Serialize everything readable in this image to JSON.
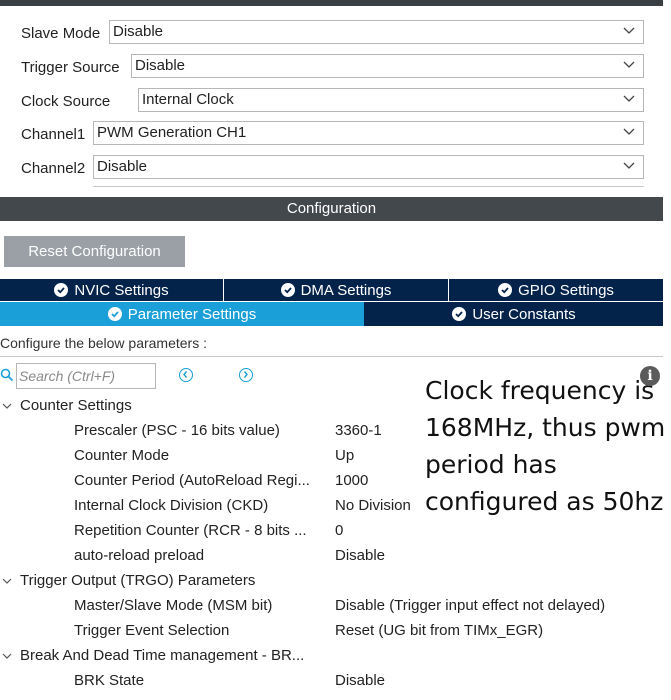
{
  "mode": {
    "slave_mode": {
      "label": "Slave Mode",
      "value": "Disable"
    },
    "trigger_source": {
      "label": "Trigger Source",
      "value": "Disable"
    },
    "clock_source": {
      "label": "Clock Source",
      "value": "Internal Clock"
    },
    "channel1": {
      "label": "Channel1",
      "value": "PWM Generation CH1"
    },
    "channel2": {
      "label": "Channel2",
      "value": "Disable"
    }
  },
  "configuration": {
    "title": "Configuration",
    "reset_button": "Reset Configuration",
    "tabs_row1": [
      "NVIC Settings",
      "DMA Settings",
      "GPIO Settings"
    ],
    "tabs_row2": [
      "Parameter Settings",
      "User Constants"
    ],
    "active_tab": "Parameter Settings",
    "configure_text": "Configure the below parameters :",
    "search_placeholder": "Search (Ctrl+F)"
  },
  "parameters": {
    "counter_settings": {
      "title": "Counter Settings",
      "rows": [
        {
          "name": "Prescaler (PSC - 16 bits value)",
          "value": "3360-1"
        },
        {
          "name": "Counter Mode",
          "value": "Up"
        },
        {
          "name": "Counter Period (AutoReload Regi...",
          "value": "1000"
        },
        {
          "name": "Internal Clock Division (CKD)",
          "value": "No Division"
        },
        {
          "name": "Repetition Counter (RCR - 8 bits ...",
          "value": "0"
        },
        {
          "name": "auto-reload preload",
          "value": "Disable"
        }
      ]
    },
    "trgo": {
      "title": "Trigger Output (TRGO) Parameters",
      "rows": [
        {
          "name": "Master/Slave Mode (MSM bit)",
          "value": "Disable (Trigger input effect not delayed)"
        },
        {
          "name": "Trigger Event Selection",
          "value": "Reset (UG bit from TIMx_EGR)"
        }
      ]
    },
    "break": {
      "title": "Break And Dead Time management - BR...",
      "rows": [
        {
          "name": "BRK State",
          "value": "Disable"
        }
      ]
    }
  },
  "annotation": {
    "lines": [
      "Clock frequency is",
      "168MHz, thus pwm",
      "period has",
      "configured as 50hz"
    ]
  },
  "icons": {
    "dropdown": "chevron-down-icon",
    "search": "search-icon",
    "tab_check": "check-circle-icon",
    "info": "info-icon"
  },
  "colors": {
    "tab_dark": "#03234b",
    "tab_active": "#1a9fd8",
    "header_bar": "#43484d",
    "button": "#9aa0a6"
  }
}
